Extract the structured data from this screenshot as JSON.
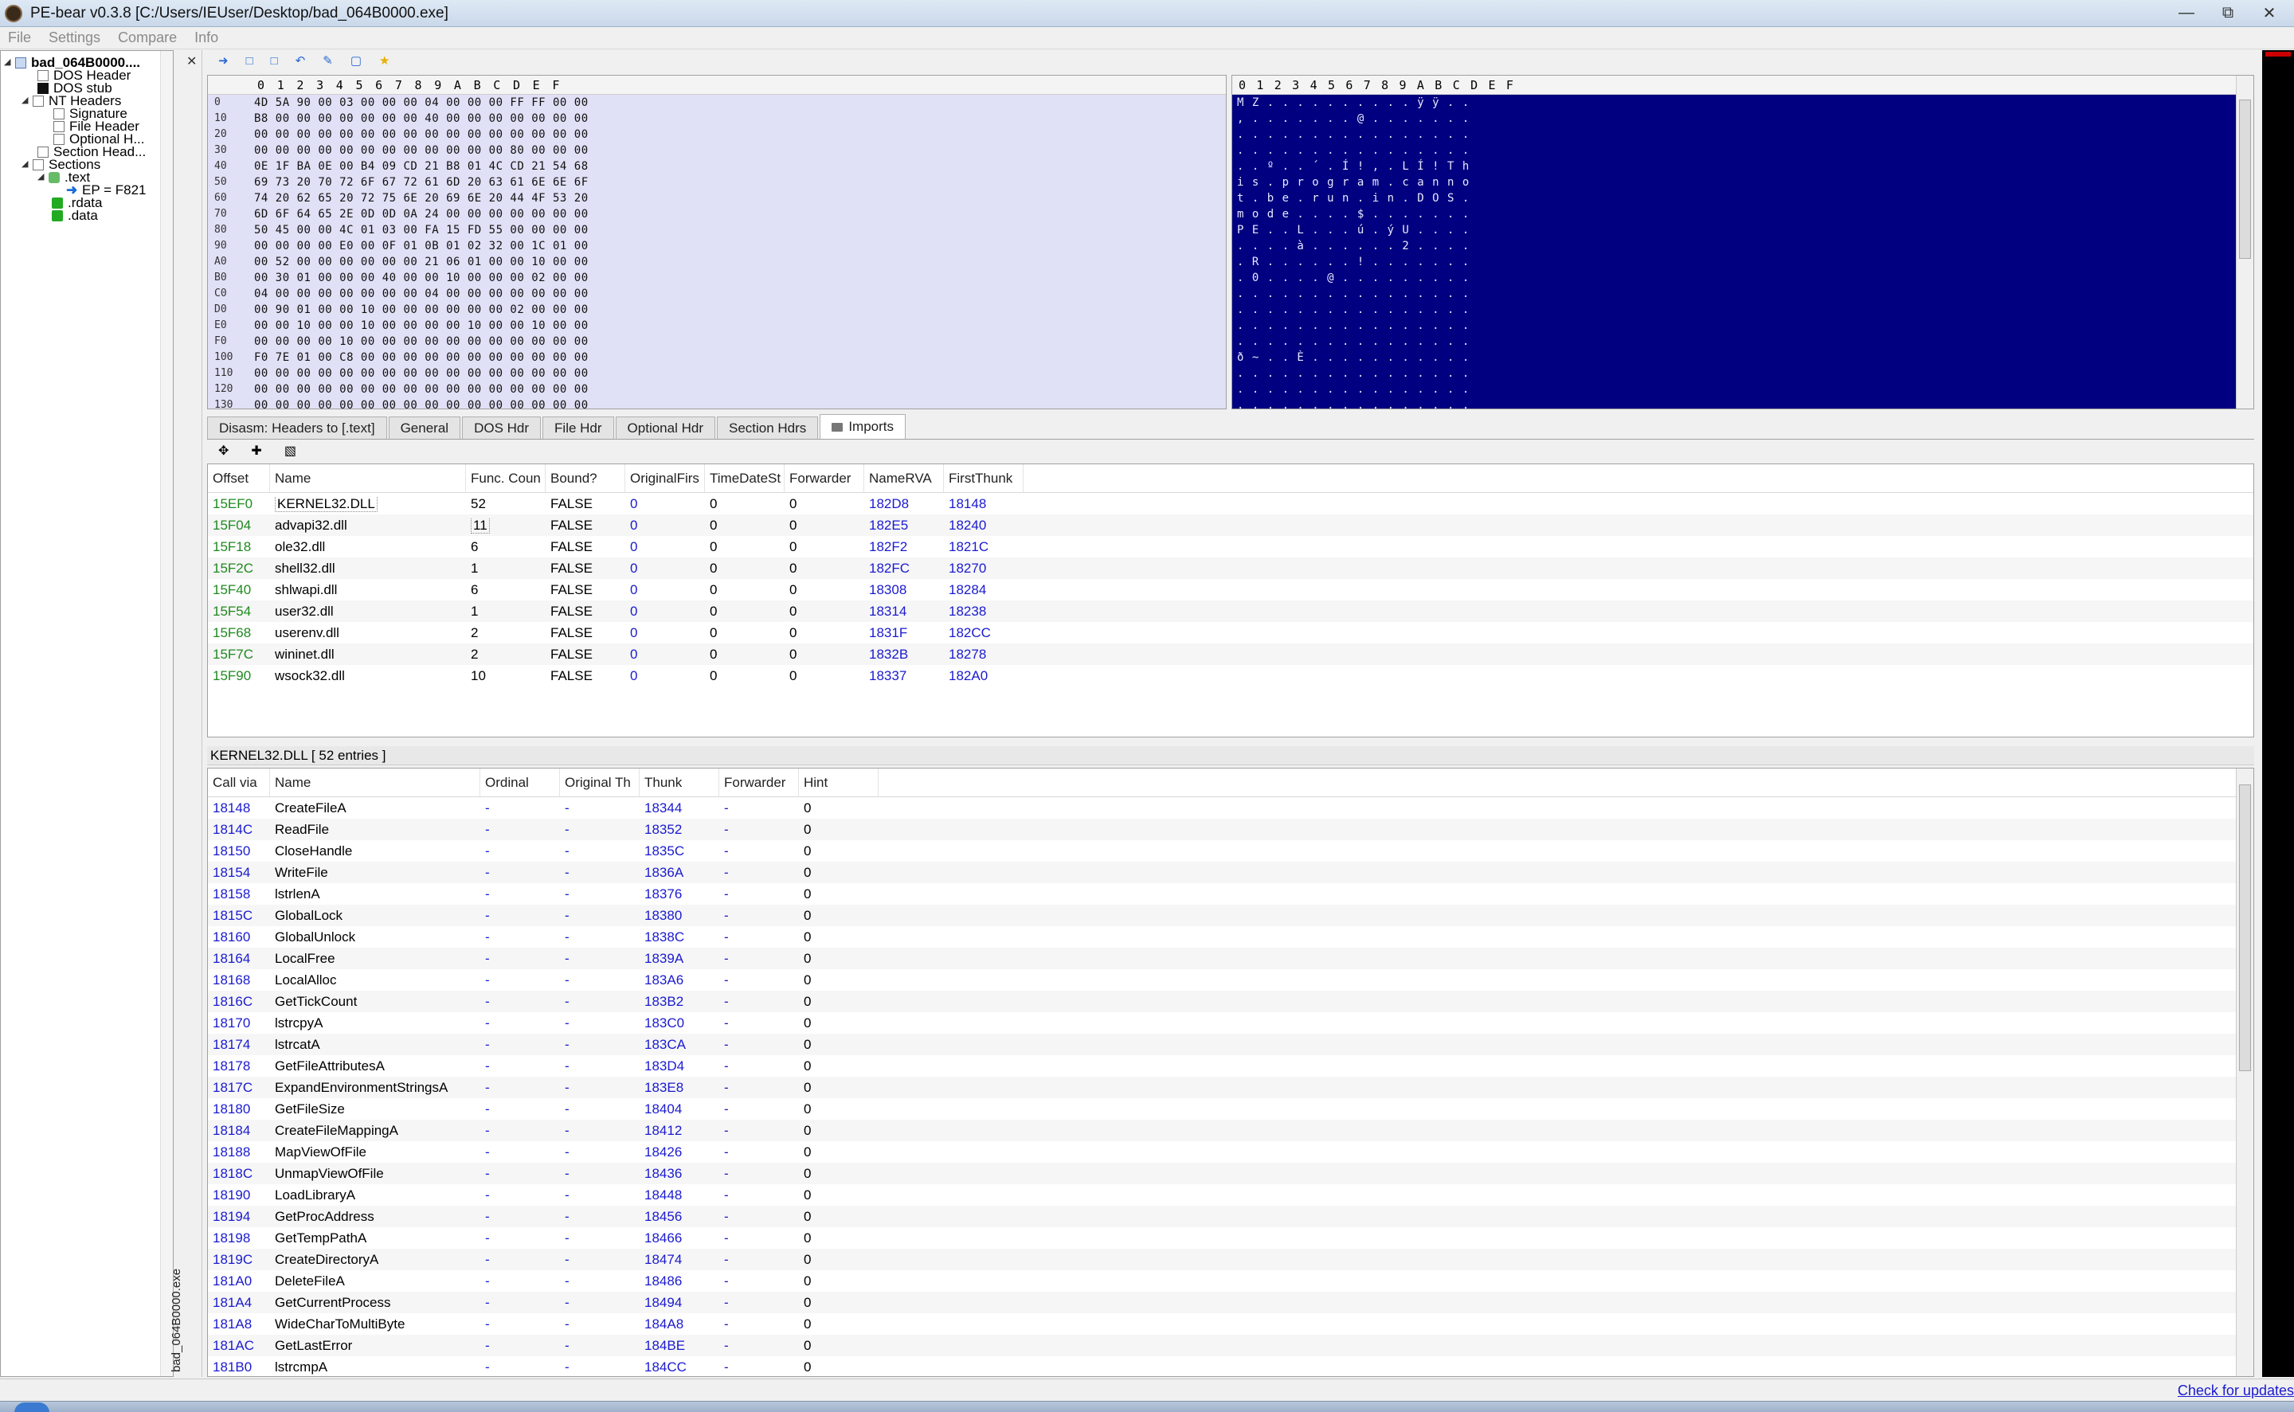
{
  "window": {
    "title": "PE-bear v0.3.8 [C:/Users/IEUser/Desktop/bad_064B0000.exe]",
    "buttons": {
      "minimize": "—",
      "restore": "⧉",
      "close": "✕"
    }
  },
  "menu": [
    "File",
    "Settings",
    "Compare",
    "Info"
  ],
  "tree": {
    "root": "bad_064B0000....",
    "items": [
      "DOS Header",
      "DOS stub",
      "NT Headers",
      "Signature",
      "File Header",
      "Optional H...",
      "Section Head...",
      "Sections",
      ".text",
      "EP = F821",
      ".rdata",
      ".data"
    ]
  },
  "side_label": "bad_064B0000.exe",
  "hex": {
    "columns": [
      "0",
      "1",
      "2",
      "3",
      "4",
      "5",
      "6",
      "7",
      "8",
      "9",
      "A",
      "B",
      "C",
      "D",
      "E",
      "F"
    ],
    "offsets": [
      "0",
      "10",
      "20",
      "30",
      "40",
      "50",
      "60",
      "70",
      "80",
      "90",
      "A0",
      "B0",
      "C0",
      "D0",
      "E0",
      "F0",
      "100",
      "110",
      "120",
      "130"
    ],
    "rows": [
      "4D 5A 90 00 03 00 00 00 04 00 00 00 FF FF 00 00",
      "B8 00 00 00 00 00 00 00 40 00 00 00 00 00 00 00",
      "00 00 00 00 00 00 00 00 00 00 00 00 00 00 00 00",
      "00 00 00 00 00 00 00 00 00 00 00 00 80 00 00 00",
      "0E 1F BA 0E 00 B4 09 CD 21 B8 01 4C CD 21 54 68",
      "69 73 20 70 72 6F 67 72 61 6D 20 63 61 6E 6E 6F",
      "74 20 62 65 20 72 75 6E 20 69 6E 20 44 4F 53 20",
      "6D 6F 64 65 2E 0D 0D 0A 24 00 00 00 00 00 00 00",
      "50 45 00 00 4C 01 03 00 FA 15 FD 55 00 00 00 00",
      "00 00 00 00 E0 00 0F 01 0B 01 02 32 00 1C 01 00",
      "00 52 00 00 00 00 00 00 21 06 01 00 00 10 00 00",
      "00 30 01 00 00 00 40 00 00 10 00 00 00 02 00 00",
      "04 00 00 00 00 00 00 00 04 00 00 00 00 00 00 00",
      "00 90 01 00 00 10 00 00 00 00 00 00 02 00 00 00",
      "00 00 10 00 00 10 00 00 00 00 10 00 00 10 00 00",
      "00 00 00 00 10 00 00 00 00 00 00 00 00 00 00 00",
      "F0 7E 01 00 C8 00 00 00 00 00 00 00 00 00 00 00",
      "00 00 00 00 00 00 00 00 00 00 00 00 00 00 00 00",
      "00 00 00 00 00 00 00 00 00 00 00 00 00 00 00 00",
      "00 00 00 00 00 00 00 00 00 00 00 00 00 00 00 00"
    ],
    "ascii": [
      "M Z . . . . . . . . . . ÿ ÿ . .",
      ", . . . . . . . @ . . . . . . .",
      ". . . . . . . . . . . . . . . .",
      ". . . . . . . . . . . . . . . .",
      ". . º . . ´ . Í ! , . L Í ! T h",
      "i s . p r o g r a m . c a n n o",
      "t . b e . r u n . i n . D O S .",
      "m o d e . . . . $ . . . . . . .",
      "P E . . L . . . ú . ý U . . . .",
      ". . . . à . . . . . . 2 . . . .",
      ". R . . . . . . ! . . . . . . .",
      ". 0 . . . . @ . . . . . . . . .",
      ". . . . . . . . . . . . . . . .",
      ". . . . . . . . . . . . . . . .",
      ". . . . . . . . . . . . . . . .",
      ". . . . . . . . . . . . . . . .",
      "ð ~ . . È . . . . . . . . . . .",
      ". . . . . . . . . . . . . . . .",
      ". . . . . . . . . . . . . . . .",
      ". . . . . . . . . . . . . . . ."
    ]
  },
  "tabs": [
    "Disasm: Headers to [.text]",
    "General",
    "DOS Hdr",
    "File Hdr",
    "Optional Hdr",
    "Section Hdrs",
    "Imports"
  ],
  "active_tab": "Imports",
  "imports": {
    "columns": [
      "Offset",
      "Name",
      "Func. Coun",
      "Bound?",
      "OriginalFirs",
      "TimeDateSt",
      "Forwarder",
      "NameRVA",
      "FirstThunk"
    ],
    "rows": [
      [
        "15EF0",
        "KERNEL32.DLL",
        "52",
        "FALSE",
        "0",
        "0",
        "0",
        "182D8",
        "18148"
      ],
      [
        "15F04",
        "advapi32.dll",
        "11",
        "FALSE",
        "0",
        "0",
        "0",
        "182E5",
        "18240"
      ],
      [
        "15F18",
        "ole32.dll",
        "6",
        "FALSE",
        "0",
        "0",
        "0",
        "182F2",
        "1821C"
      ],
      [
        "15F2C",
        "shell32.dll",
        "1",
        "FALSE",
        "0",
        "0",
        "0",
        "182FC",
        "18270"
      ],
      [
        "15F40",
        "shlwapi.dll",
        "6",
        "FALSE",
        "0",
        "0",
        "0",
        "18308",
        "18284"
      ],
      [
        "15F54",
        "user32.dll",
        "1",
        "FALSE",
        "0",
        "0",
        "0",
        "18314",
        "18238"
      ],
      [
        "15F68",
        "userenv.dll",
        "2",
        "FALSE",
        "0",
        "0",
        "0",
        "1831F",
        "182CC"
      ],
      [
        "15F7C",
        "wininet.dll",
        "2",
        "FALSE",
        "0",
        "0",
        "0",
        "1832B",
        "18278"
      ],
      [
        "15F90",
        "wsock32.dll",
        "10",
        "FALSE",
        "0",
        "0",
        "0",
        "18337",
        "182A0"
      ]
    ]
  },
  "kernel": {
    "caption": "KERNEL32.DLL   [ 52 entries ]",
    "columns": [
      "Call via",
      "Name",
      "Ordinal",
      "Original Th",
      "Thunk",
      "Forwarder",
      "Hint"
    ],
    "rows": [
      [
        "18148",
        "CreateFileA",
        "-",
        "-",
        "18344",
        "-",
        "0"
      ],
      [
        "1814C",
        "ReadFile",
        "-",
        "-",
        "18352",
        "-",
        "0"
      ],
      [
        "18150",
        "CloseHandle",
        "-",
        "-",
        "1835C",
        "-",
        "0"
      ],
      [
        "18154",
        "WriteFile",
        "-",
        "-",
        "1836A",
        "-",
        "0"
      ],
      [
        "18158",
        "lstrlenA",
        "-",
        "-",
        "18376",
        "-",
        "0"
      ],
      [
        "1815C",
        "GlobalLock",
        "-",
        "-",
        "18380",
        "-",
        "0"
      ],
      [
        "18160",
        "GlobalUnlock",
        "-",
        "-",
        "1838C",
        "-",
        "0"
      ],
      [
        "18164",
        "LocalFree",
        "-",
        "-",
        "1839A",
        "-",
        "0"
      ],
      [
        "18168",
        "LocalAlloc",
        "-",
        "-",
        "183A6",
        "-",
        "0"
      ],
      [
        "1816C",
        "GetTickCount",
        "-",
        "-",
        "183B2",
        "-",
        "0"
      ],
      [
        "18170",
        "lstrcpyA",
        "-",
        "-",
        "183C0",
        "-",
        "0"
      ],
      [
        "18174",
        "lstrcatA",
        "-",
        "-",
        "183CA",
        "-",
        "0"
      ],
      [
        "18178",
        "GetFileAttributesA",
        "-",
        "-",
        "183D4",
        "-",
        "0"
      ],
      [
        "1817C",
        "ExpandEnvironmentStringsA",
        "-",
        "-",
        "183E8",
        "-",
        "0"
      ],
      [
        "18180",
        "GetFileSize",
        "-",
        "-",
        "18404",
        "-",
        "0"
      ],
      [
        "18184",
        "CreateFileMappingA",
        "-",
        "-",
        "18412",
        "-",
        "0"
      ],
      [
        "18188",
        "MapViewOfFile",
        "-",
        "-",
        "18426",
        "-",
        "0"
      ],
      [
        "1818C",
        "UnmapViewOfFile",
        "-",
        "-",
        "18436",
        "-",
        "0"
      ],
      [
        "18190",
        "LoadLibraryA",
        "-",
        "-",
        "18448",
        "-",
        "0"
      ],
      [
        "18194",
        "GetProcAddress",
        "-",
        "-",
        "18456",
        "-",
        "0"
      ],
      [
        "18198",
        "GetTempPathA",
        "-",
        "-",
        "18466",
        "-",
        "0"
      ],
      [
        "1819C",
        "CreateDirectoryA",
        "-",
        "-",
        "18474",
        "-",
        "0"
      ],
      [
        "181A0",
        "DeleteFileA",
        "-",
        "-",
        "18486",
        "-",
        "0"
      ],
      [
        "181A4",
        "GetCurrentProcess",
        "-",
        "-",
        "18494",
        "-",
        "0"
      ],
      [
        "181A8",
        "WideCharToMultiByte",
        "-",
        "-",
        "184A8",
        "-",
        "0"
      ],
      [
        "181AC",
        "GetLastError",
        "-",
        "-",
        "184BE",
        "-",
        "0"
      ],
      [
        "181B0",
        "lstrcmpA",
        "-",
        "-",
        "184CC",
        "-",
        "0"
      ]
    ]
  },
  "status": {
    "update_link": "Check for updates"
  },
  "colors": {
    "hex_bg": "#e0e0f6",
    "ascii_bg": "#000080",
    "offset_green": "#1f8a1f",
    "link_blue": "#1a1ad0"
  }
}
